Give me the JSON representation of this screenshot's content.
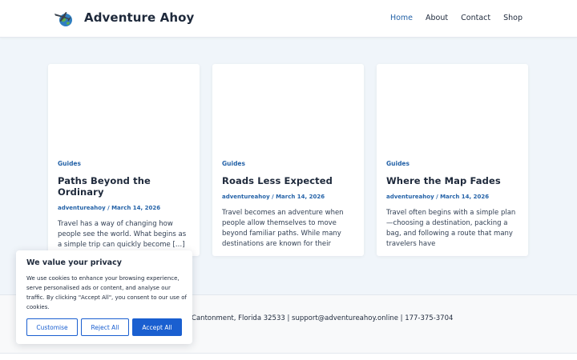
{
  "site": {
    "title": "Adventure Ahoy"
  },
  "nav": {
    "items": [
      {
        "label": "Home",
        "active": true
      },
      {
        "label": "About",
        "active": false
      },
      {
        "label": "Contact",
        "active": false
      },
      {
        "label": "Shop",
        "active": false
      }
    ]
  },
  "posts": [
    {
      "category": "Guides",
      "title": "Paths Beyond the Ordinary",
      "author": "adventureahoy",
      "date": "March 14, 2026",
      "excerpt": "Travel has a way of changing how people see the world. What begins as a simple trip can quickly become […]"
    },
    {
      "category": "Guides",
      "title": "Roads Less Expected",
      "author": "adventureahoy",
      "date": "March 14, 2026",
      "excerpt": "Travel becomes an adventure when people allow themselves to move beyond familiar paths. While many destinations are known for their"
    },
    {
      "category": "Guides",
      "title": "Where the Map Fades",
      "author": "adventureahoy",
      "date": "March 14, 2026",
      "excerpt": "Travel often begins with a simple plan—choosing a destination, packing a bag, and following a route that many travelers have"
    }
  ],
  "meta_separator": " / ",
  "footer": {
    "contact_line": "t Cantonment, Florida 32533 | support@adventureahoy.online | 177-375-3704"
  },
  "cookie_banner": {
    "title": "We value your privacy",
    "text": "We use cookies to enhance your browsing experience, serve personalised ads or content, and analyse our traffic. By clicking \"Accept All\", you consent to our use of cookies.",
    "customise_label": "Customise",
    "reject_label": "Reject All",
    "accept_label": "Accept All"
  },
  "colors": {
    "accent": "#2563a8",
    "button": "#1a5fd0",
    "page_bg": "#f0f5fa"
  },
  "icons": {
    "logo": "airplane-globe-icon"
  }
}
